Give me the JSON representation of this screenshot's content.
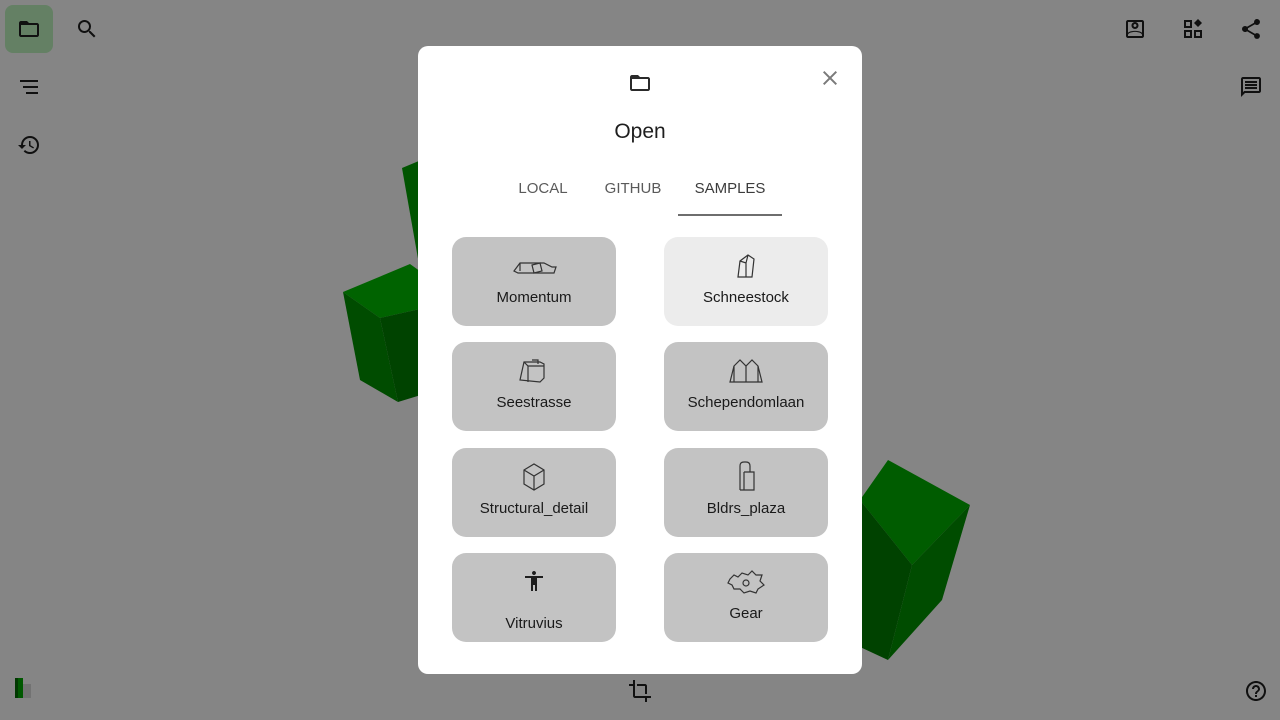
{
  "dialog": {
    "title": "Open",
    "tabs": [
      {
        "label": "LOCAL"
      },
      {
        "label": "GITHUB"
      },
      {
        "label": "SAMPLES"
      }
    ],
    "selected_tab": "SAMPLES",
    "samples": [
      {
        "label": "Momentum",
        "icon": "momentum-model-icon"
      },
      {
        "label": "Schneestock",
        "icon": "schneestock-model-icon"
      },
      {
        "label": "Seestrasse",
        "icon": "seestrasse-model-icon"
      },
      {
        "label": "Schependomlaan",
        "icon": "schependomlaan-model-icon"
      },
      {
        "label": "Structural_detail",
        "icon": "structural-detail-model-icon"
      },
      {
        "label": "Bldrs_plaza",
        "icon": "bldrs-plaza-model-icon"
      },
      {
        "label": "Vitruvius",
        "icon": "vitruvius-figure-icon"
      },
      {
        "label": "Gear",
        "icon": "gear-model-icon"
      }
    ]
  },
  "colors": {
    "scene_background": "#f3f3f3",
    "cube_green": "#00a000",
    "active_button": "#b6eab6",
    "card_background": "#c3c3c3",
    "card_hover": "#ececec"
  },
  "toolbar": {
    "left": [
      "folder-icon",
      "search-icon",
      "navigation-tree-icon",
      "history-icon"
    ],
    "right": [
      "profile-icon",
      "apps-icon",
      "share-icon",
      "notes-icon"
    ],
    "bottom": [
      "logo-icon",
      "crop-icon",
      "help-icon"
    ]
  }
}
